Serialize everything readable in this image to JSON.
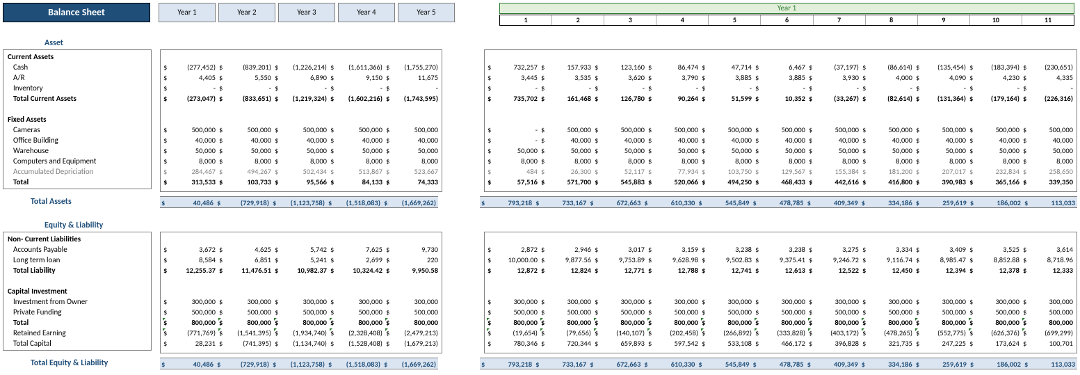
{
  "title": "Balance Sheet",
  "year_headers": [
    "Year 1",
    "Year 2",
    "Year 3",
    "Year 4",
    "Year 5"
  ],
  "month_year_label": "Year 1",
  "month_headers": [
    "1",
    "2",
    "3",
    "4",
    "5",
    "6",
    "7",
    "8",
    "9",
    "10",
    "11"
  ],
  "section_asset": "Asset",
  "section_equity": "Equity & Liability",
  "grand_assets": "Total Assets",
  "grand_equity": "Total Equity & Liability",
  "labels": {
    "current_assets": "Current Assets",
    "cash": "Cash",
    "ar": "A/R",
    "inventory": "Inventory",
    "total_current_assets": "Total Current Assets",
    "fixed_assets": "Fixed Assets",
    "cameras": "Cameras",
    "office_building": "Office Building",
    "warehouse": "Warehouse",
    "computers": "Computers and Equipment",
    "accum_dep": "Accumulated Depriciation",
    "total_fixed": "Total",
    "non_current": "Non- Current Liabilities",
    "ap": "Accounts Payable",
    "ltl": "Long term loan",
    "total_liab": "Total Liability",
    "cap_inv": "Capital Investment",
    "inv_owner": "Investment from Owner",
    "priv_fund": "Private Funding",
    "cap_total": "Total",
    "ret_earn": "Retained Earning",
    "total_cap": "Total Capital"
  },
  "years": {
    "cash": [
      "(277,452)",
      "(839,201)",
      "(1,226,214)",
      "(1,611,366)",
      "(1,755,270)"
    ],
    "ar": [
      "4,405",
      "5,550",
      "6,890",
      "9,150",
      "11,675"
    ],
    "inventory": [
      "-",
      "-",
      "-",
      "-",
      "-"
    ],
    "tca": [
      "(273,047)",
      "(833,651)",
      "(1,219,324)",
      "(1,602,216)",
      "(1,743,595)"
    ],
    "cameras": [
      "500,000",
      "500,000",
      "500,000",
      "500,000",
      "500,000"
    ],
    "office": [
      "40,000",
      "40,000",
      "40,000",
      "40,000",
      "40,000"
    ],
    "warehouse": [
      "50,000",
      "50,000",
      "50,000",
      "50,000",
      "50,000"
    ],
    "computers": [
      "8,000",
      "8,000",
      "8,000",
      "8,000",
      "8,000"
    ],
    "accdep": [
      "284,467",
      "494,267",
      "502,434",
      "513,867",
      "523,667"
    ],
    "tf": [
      "313,533",
      "103,733",
      "95,566",
      "84,133",
      "74,333"
    ],
    "ap": [
      "3,672",
      "4,625",
      "5,742",
      "7,625",
      "9,730"
    ],
    "ltl": [
      "8,584",
      "6,851",
      "5,241",
      "2,699",
      "220"
    ],
    "tl": [
      "12,255.37",
      "11,476.51",
      "10,982.37",
      "10,324.42",
      "9,950.58"
    ],
    "owner": [
      "300,000",
      "300,000",
      "300,000",
      "300,000",
      "300,000"
    ],
    "priv": [
      "500,000",
      "500,000",
      "500,000",
      "500,000",
      "500,000"
    ],
    "ctot": [
      "800,000",
      "800,000",
      "800,000",
      "800,000",
      "800,000"
    ],
    "ret": [
      "(771,769)",
      "(1,541,395)",
      "(1,934,740)",
      "(2,328,408)",
      "(2,479,213)"
    ],
    "tcap": [
      "28,231",
      "(741,395)",
      "(1,134,740)",
      "(1,528,408)",
      "(1,679,213)"
    ],
    "grand": [
      "40,486",
      "(729,918)",
      "(1,123,758)",
      "(1,518,083)",
      "(1,669,262)"
    ]
  },
  "months": {
    "cash": [
      "732,257",
      "157,933",
      "123,160",
      "86,474",
      "47,714",
      "6,467",
      "(37,197)",
      "(86,614)",
      "(135,454)",
      "(183,394)",
      "(230,651)"
    ],
    "ar": [
      "3,445",
      "3,535",
      "3,620",
      "3,790",
      "3,885",
      "3,885",
      "3,930",
      "4,000",
      "4,090",
      "4,230",
      "4,335"
    ],
    "inventory": [
      "-",
      "-",
      "-",
      "-",
      "-",
      "-",
      "-",
      "-",
      "-",
      "-",
      "-"
    ],
    "tca": [
      "735,702",
      "161,468",
      "126,780",
      "90,264",
      "51,599",
      "10,352",
      "(33,267)",
      "(82,614)",
      "(131,364)",
      "(179,164)",
      "(226,316)"
    ],
    "cameras": [
      "-",
      "500,000",
      "500,000",
      "500,000",
      "500,000",
      "500,000",
      "500,000",
      "500,000",
      "500,000",
      "500,000",
      "500,000"
    ],
    "office": [
      "-",
      "40,000",
      "40,000",
      "40,000",
      "40,000",
      "40,000",
      "40,000",
      "40,000",
      "40,000",
      "40,000",
      "40,000"
    ],
    "warehouse": [
      "50,000",
      "50,000",
      "50,000",
      "50,000",
      "50,000",
      "50,000",
      "50,000",
      "50,000",
      "50,000",
      "50,000",
      "50,000"
    ],
    "computers": [
      "8,000",
      "8,000",
      "8,000",
      "8,000",
      "8,000",
      "8,000",
      "8,000",
      "8,000",
      "8,000",
      "8,000",
      "8,000"
    ],
    "accdep": [
      "484",
      "26,300",
      "52,117",
      "77,934",
      "103,750",
      "129,567",
      "155,384",
      "181,200",
      "207,017",
      "232,834",
      "258,650"
    ],
    "tf": [
      "57,516",
      "571,700",
      "545,883",
      "520,066",
      "494,250",
      "468,433",
      "442,616",
      "416,800",
      "390,983",
      "365,166",
      "339,350"
    ],
    "ap": [
      "2,872",
      "2,946",
      "3,017",
      "3,159",
      "3,238",
      "3,238",
      "3,275",
      "3,334",
      "3,409",
      "3,525",
      "3,614"
    ],
    "ltl": [
      "10,000.00",
      "9,877.56",
      "9,753.89",
      "9,628.98",
      "9,502.83",
      "9,375.41",
      "9,246.72",
      "9,116.74",
      "8,985.47",
      "8,852.88",
      "8,718.96"
    ],
    "tl": [
      "12,872",
      "12,824",
      "12,771",
      "12,788",
      "12,741",
      "12,613",
      "12,522",
      "12,450",
      "12,394",
      "12,378",
      "12,333"
    ],
    "owner": [
      "300,000",
      "300,000",
      "300,000",
      "300,000",
      "300,000",
      "300,000",
      "300,000",
      "300,000",
      "300,000",
      "300,000",
      "300,000"
    ],
    "priv": [
      "500,000",
      "500,000",
      "500,000",
      "500,000",
      "500,000",
      "500,000",
      "500,000",
      "500,000",
      "500,000",
      "500,000",
      "500,000"
    ],
    "ctot": [
      "800,000",
      "800,000",
      "800,000",
      "800,000",
      "800,000",
      "800,000",
      "800,000",
      "800,000",
      "800,000",
      "800,000",
      "800,000"
    ],
    "ret": [
      "(19,654)",
      "(79,656)",
      "(140,107)",
      "(202,458)",
      "(266,892)",
      "(333,828)",
      "(403,172)",
      "(478,265)",
      "(552,775)",
      "(626,376)",
      "(699,299)"
    ],
    "tcap": [
      "780,346",
      "720,344",
      "659,893",
      "597,542",
      "533,108",
      "466,172",
      "396,828",
      "321,735",
      "247,225",
      "173,624",
      "100,701"
    ],
    "grand": [
      "793,218",
      "733,167",
      "672,663",
      "610,330",
      "545,849",
      "478,785",
      "409,349",
      "334,186",
      "259,619",
      "186,002",
      "113,033"
    ]
  }
}
